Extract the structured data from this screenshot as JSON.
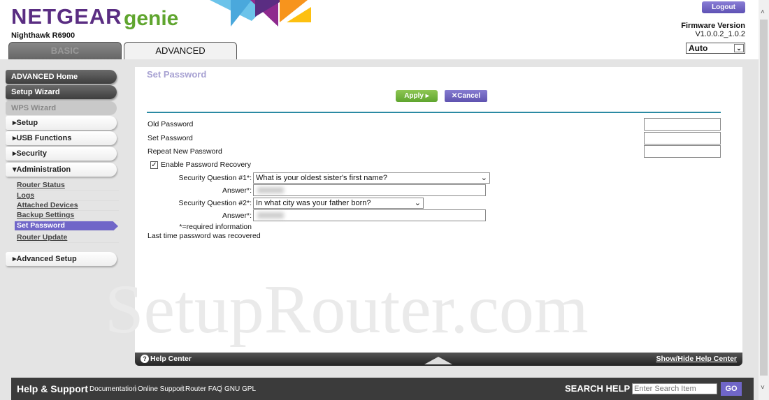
{
  "header": {
    "brand": "NETGEAR",
    "brand_suffix": "genie",
    "model": "Nighthawk R6900",
    "logout_label": "Logout",
    "firmware_label": "Firmware Version",
    "firmware_version": "V1.0.0.2_1.0.2",
    "language_select": "Auto"
  },
  "tabs": [
    {
      "label": "BASIC",
      "active": false
    },
    {
      "label": "ADVANCED",
      "active": true
    }
  ],
  "sidebar": {
    "buttons": [
      "ADVANCED Home",
      "Setup Wizard",
      "WPS Wizard"
    ],
    "sections": [
      "Setup",
      "USB Functions",
      "Security",
      "Administration"
    ],
    "admin_items": [
      "Router Status",
      "Logs",
      "Attached Devices",
      "Backup Settings",
      "Set Password",
      "Router Update"
    ],
    "active_item": "Set Password",
    "advanced_setup": "Advanced Setup"
  },
  "main": {
    "title": "Set Password",
    "apply_label": "Apply",
    "cancel_label": "Cancel",
    "old_password": "Old Password",
    "set_password": "Set Password",
    "repeat_password": "Repeat New Password",
    "enable_recovery": "Enable Password Recovery",
    "enable_recovery_checked": true,
    "question1_label": "Security Question #1*:",
    "question1_value": "What is your oldest sister's first name?",
    "answer_label": "Answer*:",
    "question2_label": "Security Question #2*:",
    "question2_value": "In what city was your father born?",
    "required_note": "*=required information",
    "last_recovered": "Last time password was recovered"
  },
  "watermark": "SetupRouter.com",
  "help_bar": {
    "help_center": "Help Center",
    "toggle": "Show/Hide Help Center"
  },
  "footer": {
    "title": "Help & Support",
    "links": [
      "Documentation",
      "Online Support",
      "Router FAQ",
      "GNU GPL"
    ],
    "search_label": "SEARCH HELP",
    "search_placeholder": "Enter Search Item",
    "go_label": "GO"
  },
  "colors": {
    "brand_purple": "#5a2d82",
    "genie_green": "#5fa52e",
    "accent_purple": "#7066c8",
    "rule_teal": "#2b8aa3"
  }
}
